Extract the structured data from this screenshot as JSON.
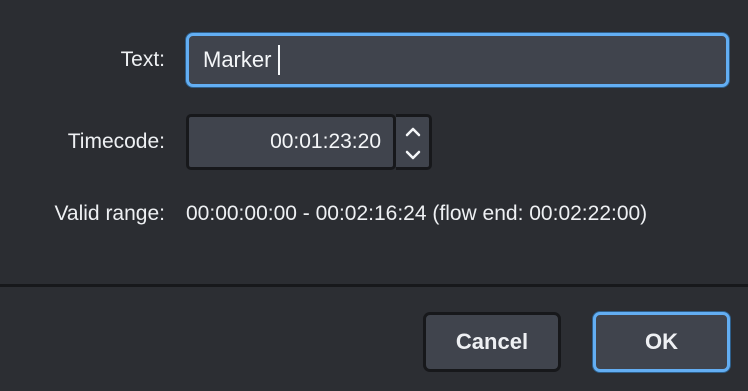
{
  "form": {
    "text_label": "Text:",
    "text_value": "Marker",
    "timecode_label": "Timecode:",
    "timecode_value": "00:01:23:20",
    "valid_range_label": "Valid range:",
    "valid_range_value": "00:00:00:00 - 00:02:16:24 (flow end: 00:02:22:00)"
  },
  "buttons": {
    "cancel_label": "Cancel",
    "ok_label": "OK"
  },
  "icons": {
    "increment": "chevron-up-icon",
    "decrement": "chevron-down-icon"
  },
  "colors": {
    "background": "#2b2d32",
    "field": "#40444d",
    "focus_accent": "#63aef3",
    "text": "#eef0f3"
  }
}
